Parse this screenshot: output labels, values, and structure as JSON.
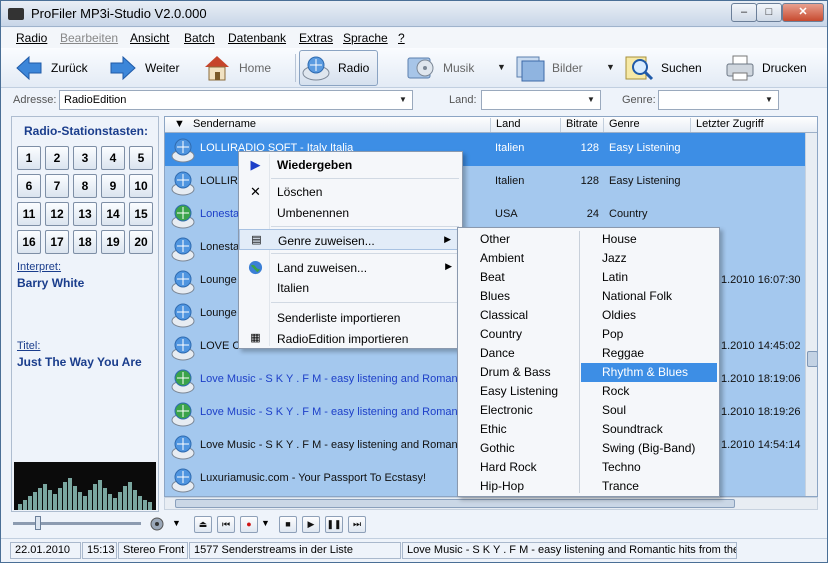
{
  "window": {
    "title": "ProFiler MP3i-Studio V2.0.000",
    "btn_min": "–",
    "btn_max": "□",
    "btn_close": "✕"
  },
  "menubar": [
    "Radio",
    "Bearbeiten",
    "Ansicht",
    "Batch",
    "Datenbank",
    "Extras",
    "Sprache",
    "?"
  ],
  "toolbar": {
    "back": "Zurück",
    "forward": "Weiter",
    "home": "Home",
    "radio": "Radio",
    "music": "Musik",
    "images": "Bilder",
    "search": "Suchen",
    "print": "Drucken"
  },
  "address": {
    "label": "Adresse:",
    "value": "RadioEdition",
    "land_label": "Land:",
    "land_value": "",
    "genre_label": "Genre:",
    "genre_value": ""
  },
  "left": {
    "title": "Radio-Stationstasten:",
    "keys": [
      "1",
      "2",
      "3",
      "4",
      "5",
      "6",
      "7",
      "8",
      "9",
      "10",
      "11",
      "12",
      "13",
      "14",
      "15",
      "16",
      "17",
      "18",
      "19",
      "20"
    ],
    "interpret_label": "Interpret:",
    "interpret_value": "Barry White",
    "title_label": "Titel:",
    "title_value": "Just The Way You Are"
  },
  "list": {
    "headers": [
      "Sendername",
      "Land",
      "Bitrate",
      "Genre",
      "Letzter Zugriff"
    ],
    "rows": [
      {
        "name": "LOLLIRADIO SOFT - Italy Italia",
        "land": "Italien",
        "bitrate": "128",
        "genre": "Easy Listening",
        "date": "",
        "selected": true,
        "blue": false
      },
      {
        "name": "LOLLIRADIO SOFT - Italy Italia",
        "land": "Italien",
        "bitrate": "128",
        "genre": "Easy Listening",
        "date": "",
        "selected": false,
        "blue": false
      },
      {
        "name": "Lonestar Radio",
        "land": "USA",
        "bitrate": "24",
        "genre": "Country",
        "date": "",
        "selected": false,
        "blue": true
      },
      {
        "name": "Lonestar Radio",
        "land": "",
        "bitrate": "",
        "genre": "",
        "date": "",
        "selected": false,
        "blue": false
      },
      {
        "name": "Lounge",
        "land": "",
        "bitrate": "",
        "genre": "",
        "date": "1.2010 16:07:30",
        "selected": false,
        "blue": false
      },
      {
        "name": "Lounge",
        "land": "",
        "bitrate": "",
        "genre": "",
        "date": "",
        "selected": false,
        "blue": false
      },
      {
        "name": "LOVE CH",
        "land": "",
        "bitrate": "",
        "genre": "",
        "date": "1.2010 14:45:02",
        "selected": false,
        "blue": false
      },
      {
        "name": "Love Music - S K Y . F M - easy listening and Romantic",
        "land": "",
        "bitrate": "",
        "genre": "",
        "date": "1.2010 18:19:06",
        "selected": false,
        "blue": true
      },
      {
        "name": "Love Music - S K Y . F M - easy listening and Romantic",
        "land": "",
        "bitrate": "",
        "genre": "",
        "date": "1.2010 18:19:26",
        "selected": false,
        "blue": true
      },
      {
        "name": "Love Music - S K Y . F M - easy listening and Romantic",
        "land": "",
        "bitrate": "",
        "genre": "",
        "date": "1.2010 14:54:14",
        "selected": false,
        "blue": false
      },
      {
        "name": "Luxuriamusic.com - Your Passport To Ecstasy!",
        "land": "",
        "bitrate": "",
        "genre": "",
        "date": "",
        "selected": false,
        "blue": false
      }
    ]
  },
  "context_menu": {
    "play": "Wiedergeben",
    "delete": "Löschen",
    "rename": "Umbenennen",
    "assign_genre": "Genre zuweisen...",
    "assign_country": "Land zuweisen...",
    "country_value": "Italien",
    "import_list": "Senderliste importieren",
    "import_radioedition": "RadioEdition importieren"
  },
  "genre_menu": {
    "left": [
      "Other",
      "Ambient",
      "Beat",
      "Blues",
      "Classical",
      "Country",
      "Dance",
      "Drum & Bass",
      "Easy Listening",
      "Electronic",
      "Ethic",
      "Gothic",
      "Hard Rock",
      "Hip-Hop"
    ],
    "right": [
      "House",
      "Jazz",
      "Latin",
      "National Folk",
      "Oldies",
      "Pop",
      "Reggae",
      "Rhythm & Blues",
      "Rock",
      "Soul",
      "Soundtrack",
      "Swing (Big-Band)",
      "Techno",
      "Trance"
    ],
    "selected": "Rhythm & Blues"
  },
  "status": {
    "date": "22.01.2010",
    "time": "15:13",
    "mode": "Stereo Front",
    "count": "1577 Senderstreams in der Liste",
    "now_playing": "Love Music - S K Y . F M - easy listening and Romantic hits from the h"
  },
  "colors": {
    "accent": "#3d8ee5",
    "list_bg": "#a4c8ee",
    "link_blue": "#1d3fc8",
    "panel_text": "#1a3d8c"
  }
}
